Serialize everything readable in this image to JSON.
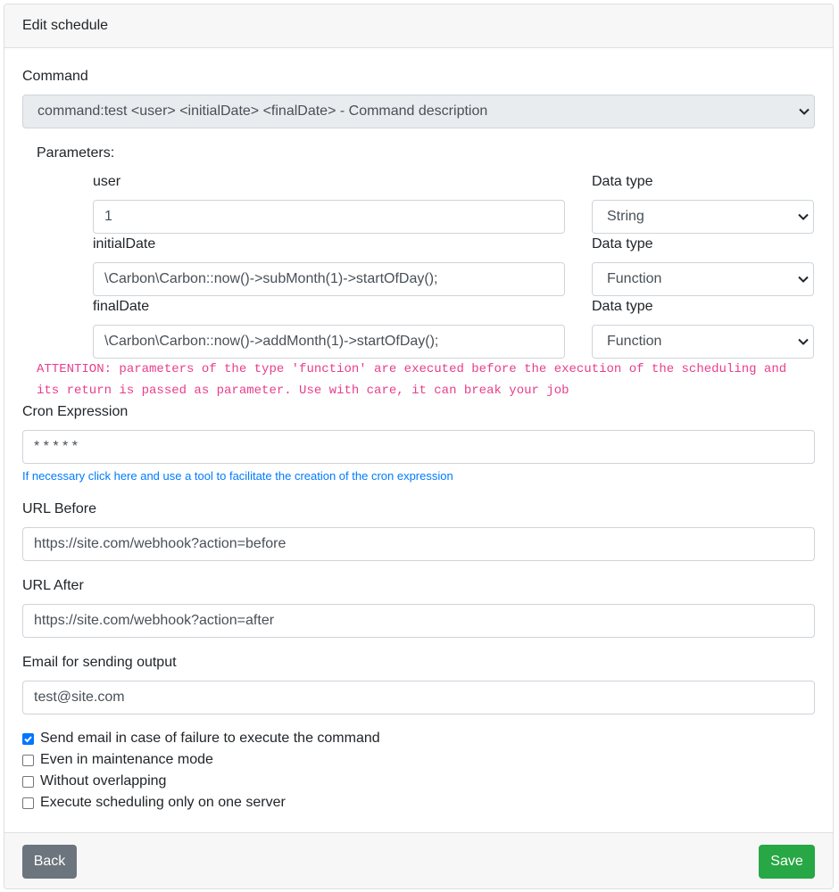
{
  "header": {
    "title": "Edit schedule"
  },
  "command": {
    "label": "Command",
    "selected": "command:test <user> <initialDate> <finalDate> - Command description"
  },
  "parameters": {
    "label": "Parameters:",
    "data_type_label": "Data type",
    "items": [
      {
        "name": "user",
        "value": "1",
        "type": "String"
      },
      {
        "name": "initialDate",
        "value": "\\Carbon\\Carbon::now()->subMonth(1)->startOfDay();",
        "type": "Function"
      },
      {
        "name": "finalDate",
        "value": "\\Carbon\\Carbon::now()->addMonth(1)->startOfDay();",
        "type": "Function"
      }
    ],
    "attention": "ATTENTION: parameters of the type 'function' are executed before the execution of the scheduling and its return is passed as parameter. Use with care, it can break your job"
  },
  "cron": {
    "label": "Cron Expression",
    "value": "* * * * *",
    "help": "If necessary click here and use a tool to facilitate the creation of the cron expression"
  },
  "url_before": {
    "label": "URL Before",
    "value": "https://site.com/webhook?action=before"
  },
  "url_after": {
    "label": "URL After",
    "value": "https://site.com/webhook?action=after"
  },
  "email": {
    "label": "Email for sending output",
    "value": "test@site.com"
  },
  "options": [
    {
      "label": "Send email in case of failure to execute the command",
      "checked": true
    },
    {
      "label": "Even in maintenance mode",
      "checked": false
    },
    {
      "label": "Without overlapping",
      "checked": false
    },
    {
      "label": "Execute scheduling only on one server",
      "checked": false
    }
  ],
  "footer": {
    "back_label": "Back",
    "save_label": "Save"
  },
  "colors": {
    "primary": "#007bff",
    "success": "#28a745",
    "secondary": "#6c757d",
    "attention": "#e83e8c",
    "checkbox": "#0075ff"
  },
  "icons": {
    "select_arrow": "chevron-down-icon",
    "checkbox_mark": "checkmark-icon"
  }
}
